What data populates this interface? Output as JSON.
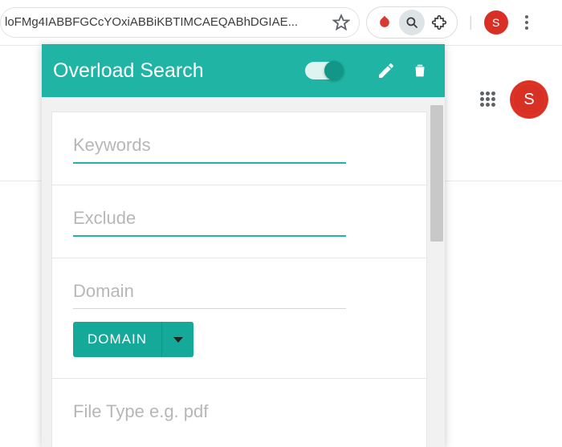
{
  "browser": {
    "address_text": "loFMg4IABBFGCcYOxiABBiKBTIMCAEQABhDGIAE...",
    "avatar_letter": "S"
  },
  "chrome_ui": {
    "big_avatar_letter": "S"
  },
  "panel": {
    "title": "Overload Search",
    "toggle_on": true,
    "fields": {
      "keywords": {
        "label": "Keywords"
      },
      "exclude": {
        "label": "Exclude"
      },
      "domain": {
        "label": "Domain",
        "button_label": "DOMAIN"
      },
      "filetype": {
        "label": "File Type e.g. pdf"
      }
    }
  }
}
